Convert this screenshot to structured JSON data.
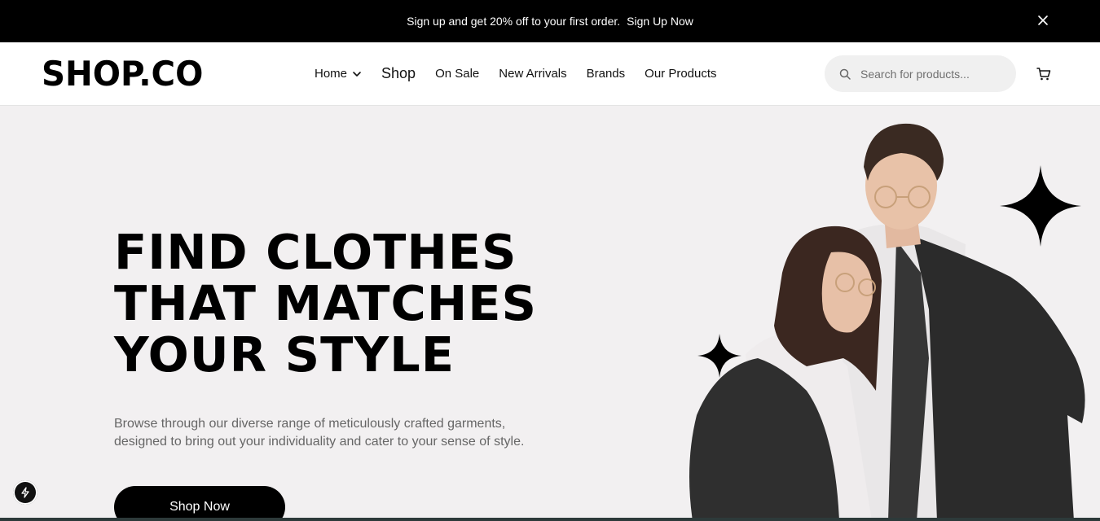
{
  "promo": {
    "text": "Sign up and get 20% off to your first order.",
    "link": "Sign Up Now"
  },
  "header": {
    "logo": "SHOP.CO",
    "nav": [
      {
        "label": "Home",
        "has_dropdown": true
      },
      {
        "label": "Shop",
        "has_dropdown": false
      },
      {
        "label": "On Sale",
        "has_dropdown": false
      },
      {
        "label": "New Arrivals",
        "has_dropdown": false
      },
      {
        "label": "Brands",
        "has_dropdown": false
      },
      {
        "label": "Our Products",
        "has_dropdown": false
      }
    ],
    "search_placeholder": "Search for products..."
  },
  "hero": {
    "title_lines": [
      "FIND CLOTHES",
      "THAT MATCHES",
      "YOUR STYLE"
    ],
    "description_lines": [
      "Browse through our diverse range of meticulously crafted garments,",
      "designed to bring out your individuality and cater to your sense of style."
    ],
    "cta": "Shop Now"
  },
  "colors": {
    "promo_bg": "#000000",
    "hero_bg": "#f2f0f1",
    "accent": "#000000"
  },
  "icons": [
    "close-icon",
    "chevron-down-icon",
    "search-icon",
    "cart-icon",
    "sparkle-icon",
    "bolt-icon"
  ]
}
